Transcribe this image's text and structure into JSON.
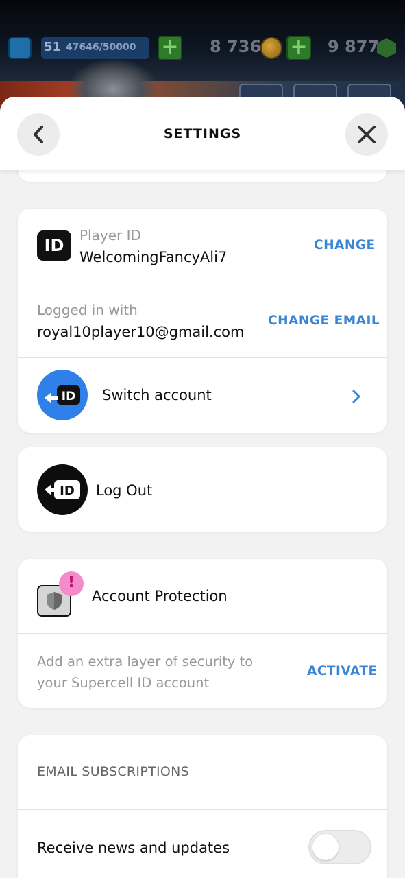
{
  "hud": {
    "level": "51",
    "xp": "47646/50000",
    "gold": "8 736",
    "gems": "9 877",
    "plus_symbol": "+"
  },
  "header": {
    "title": "SETTINGS",
    "back_icon": "chevron-left-icon",
    "close_icon": "close-icon"
  },
  "account": {
    "player_id_label": "Player ID",
    "player_id_value": "WelcomingFancyAli7",
    "player_id_badge": "ID",
    "change_label": "CHANGE",
    "logged_in_label": "Logged in with",
    "email": "royal10player10@gmail.com",
    "change_email_label": "CHANGE EMAIL",
    "switch_account_label": "Switch account",
    "switch_badge": "ID"
  },
  "logout": {
    "label": "Log Out",
    "badge": "ID"
  },
  "protection": {
    "title": "Account Protection",
    "warning_mark": "!",
    "description_line1": "Add an extra layer of security to",
    "description_line2": "your Supercell ID account",
    "activate_label": "ACTIVATE"
  },
  "email_subscriptions": {
    "heading": "EMAIL SUBSCRIPTIONS",
    "news_label": "Receive news and updates",
    "news_enabled": false
  },
  "colors": {
    "accent_link": "#3a85d6",
    "switch_circle": "#2f80e8",
    "warning_dot": "#f48ccb",
    "sheet_background": "#f2f2f2"
  }
}
